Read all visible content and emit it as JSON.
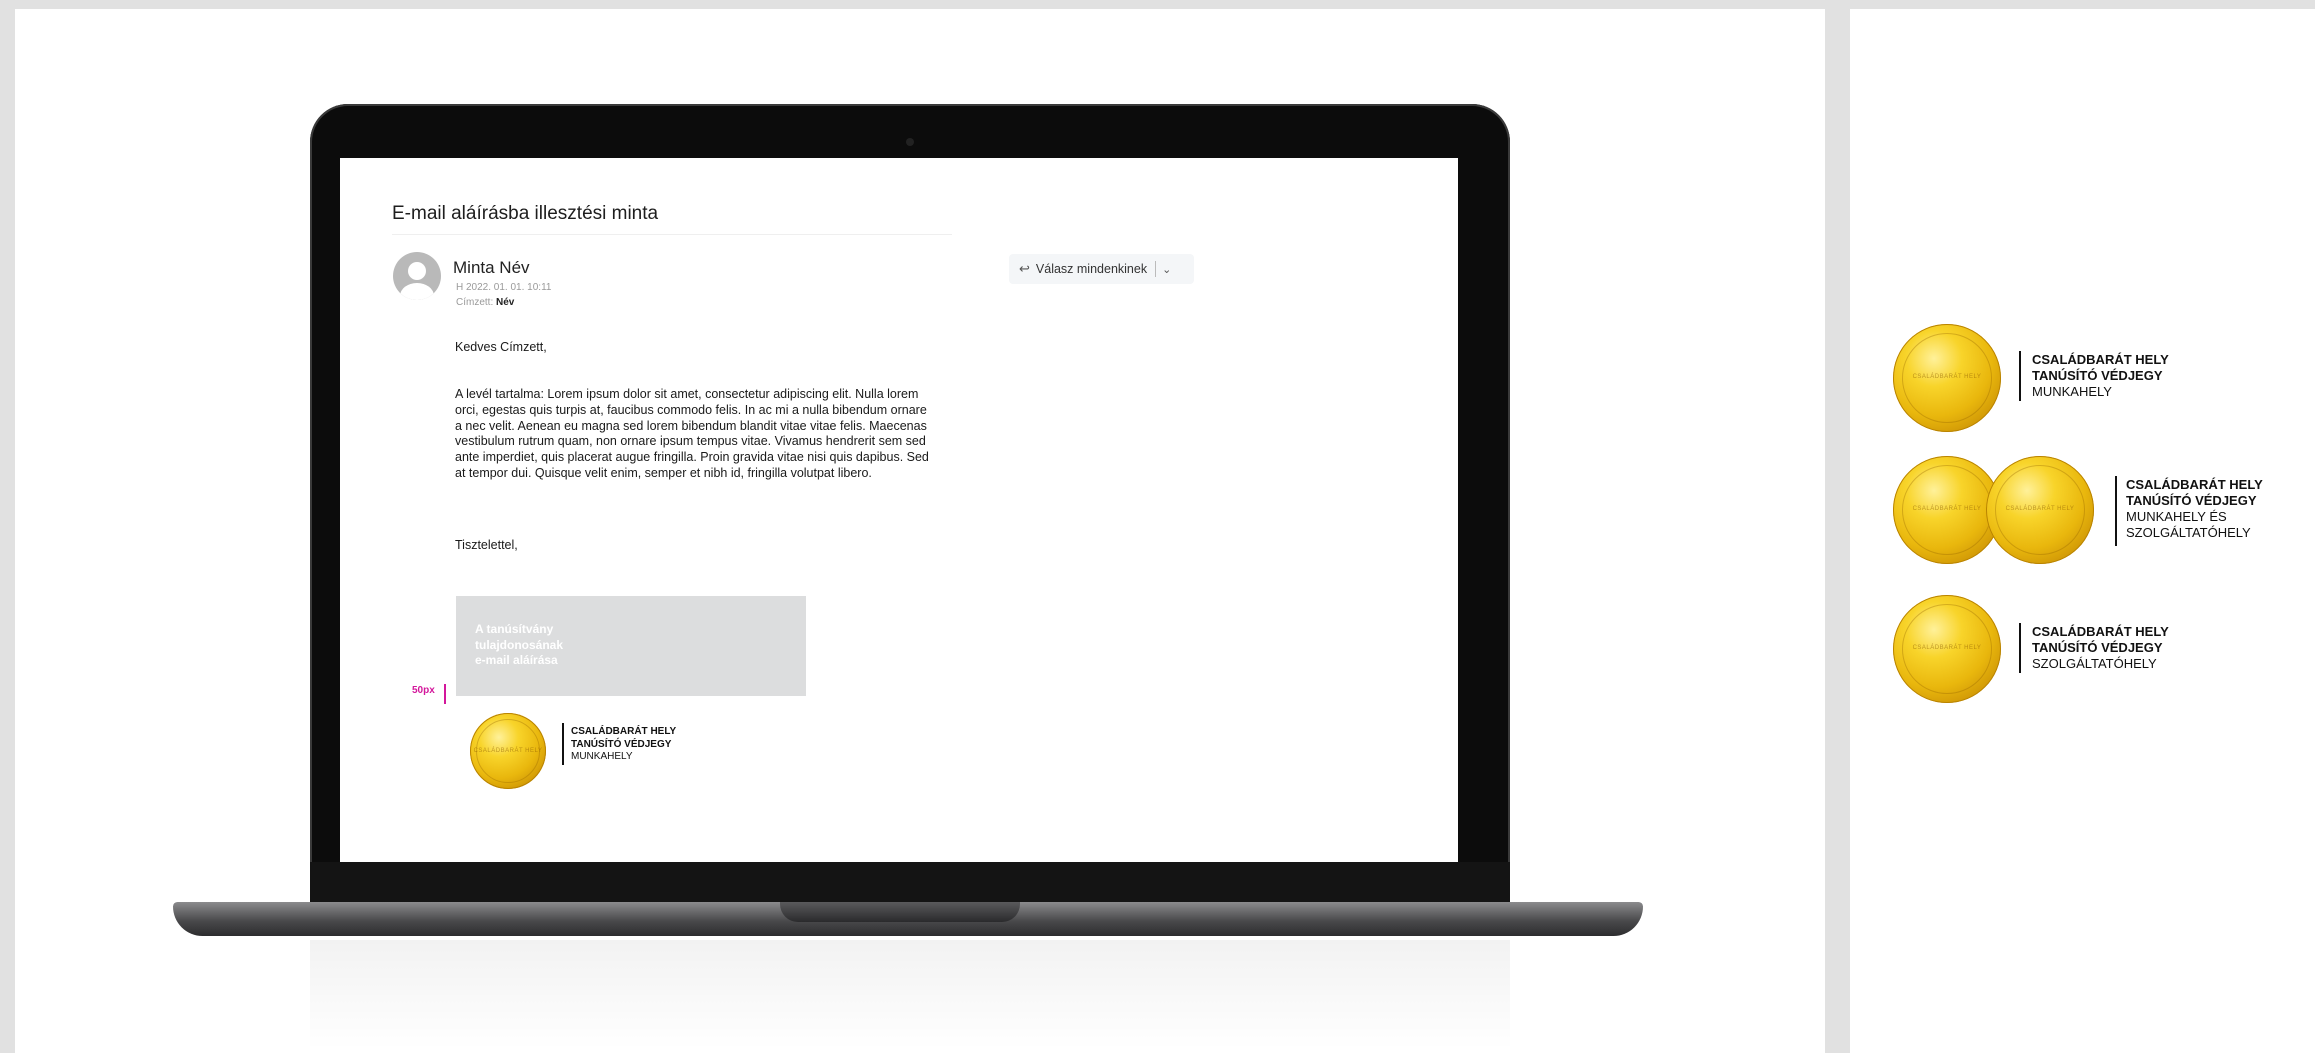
{
  "email": {
    "title": "E-mail aláírásba illesztési minta",
    "sender_name": "Minta Név",
    "date": "H 2022. 01. 01. 10:11",
    "recipient_label": "Címzett:",
    "recipient_name": "Név",
    "reply_all_label": "Válasz mindenkinek",
    "greeting": "Kedves Címzett,",
    "body": "A levél tartalma: Lorem ipsum dolor sit amet, consectetur adipiscing elit. Nulla lorem orci, egestas quis turpis at, faucibus commodo felis. In ac mi a nulla bibendum ornare a nec velit. Aenean eu magna sed lorem bibendum blandit vitae vitae felis. Maecenas vestibulum rutrum quam, non ornare ipsum tempus vitae. Vivamus hendrerit sem sed ante imperdiet, quis placerat augue fringilla. Proin gravida vitae nisi quis dapibus. Sed at tempor dui. Quisque velit enim, semper et nibh id, fringilla volutpat libero.",
    "closing": "Tisztelettel,",
    "signature_placeholder": "A tanúsítvány\ntulajdonosának\ne-mail aláírása",
    "spacing_label": "50px"
  },
  "signature_badge": {
    "line1": "CSALÁDBARÁT HELY",
    "line2": "TANÚSÍTÓ VÉDJEGY",
    "line3": "MUNKAHELY"
  },
  "badges": [
    {
      "line1": "CSALÁDBARÁT HELY",
      "line2": "TANÚSÍTÓ VÉDJEGY",
      "line3": "MUNKAHELY",
      "line4": ""
    },
    {
      "line1": "CSALÁDBARÁT HELY",
      "line2": "TANÚSÍTÓ VÉDJEGY",
      "line3": "MUNKAHELY ÉS",
      "line4": "SZOLGÁLTATÓHELY"
    },
    {
      "line1": "CSALÁDBARÁT HELY",
      "line2": "TANÚSÍTÓ VÉDJEGY",
      "line3": "SZOLGÁLTATÓHELY",
      "line4": ""
    }
  ],
  "seal_text": "CSALÁDBARÁT HELY",
  "colors": {
    "accent_magenta": "#d3179b",
    "seal_gold": "#e9b70d",
    "signature_box": "#dcddde"
  }
}
